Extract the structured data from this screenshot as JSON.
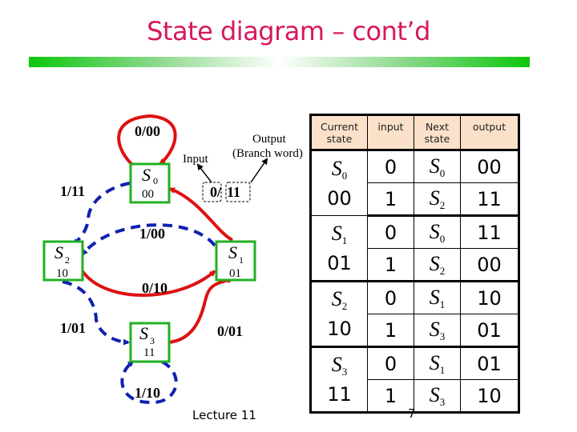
{
  "slide": {
    "title": "State diagram – cont’d",
    "footer": "Lecture 11",
    "page_number": "7",
    "colors": {
      "title": "#d6185e",
      "title_bar": "#0cc70c",
      "state_box": "#22b022",
      "input0_edge": "#dd1111",
      "input1_edge": "#1020b0",
      "table_header_bg": "#fbe1c9"
    }
  },
  "diagram": {
    "states": [
      {
        "name": "S",
        "sub": "0",
        "code": "00"
      },
      {
        "name": "S",
        "sub": "1",
        "code": "01"
      },
      {
        "name": "S",
        "sub": "2",
        "code": "10"
      },
      {
        "name": "S",
        "sub": "3",
        "code": "11"
      }
    ],
    "transitions": [
      {
        "from": "S0",
        "to": "S0",
        "label": "0/00",
        "style": "solid-red"
      },
      {
        "from": "S0",
        "to": "S2",
        "label": "1/11",
        "style": "dashed-blue"
      },
      {
        "from": "S1",
        "to": "S0",
        "label": "0/11",
        "style": "solid-red"
      },
      {
        "from": "S1",
        "to": "S2",
        "label": "1/00",
        "style": "dashed-blue"
      },
      {
        "from": "S2",
        "to": "S1",
        "label": "0/10",
        "style": "solid-red"
      },
      {
        "from": "S2",
        "to": "S3",
        "label": "1/01",
        "style": "dashed-blue"
      },
      {
        "from": "S3",
        "to": "S1",
        "label": "0/01",
        "style": "solid-red"
      },
      {
        "from": "S3",
        "to": "S3",
        "label": "1/10",
        "style": "dashed-blue"
      }
    ],
    "annotation": {
      "input_label": "Input",
      "output_label_line1": "Output",
      "output_label_line2": "(Branch word)",
      "example_input": "0/",
      "example_output": "11"
    }
  },
  "table": {
    "headers": [
      {
        "line1": "Current",
        "line2": "state"
      },
      {
        "line1": "input",
        "line2": ""
      },
      {
        "line1": "Next",
        "line2": "state"
      },
      {
        "line1": "output",
        "line2": ""
      }
    ],
    "groups": [
      {
        "state": "S",
        "sub": "0",
        "code": "00",
        "rows": [
          {
            "input": "0",
            "next": "S",
            "next_sub": "0",
            "output": "00"
          },
          {
            "input": "1",
            "next": "S",
            "next_sub": "2",
            "output": "11"
          }
        ]
      },
      {
        "state": "S",
        "sub": "1",
        "code": "01",
        "rows": [
          {
            "input": "0",
            "next": "S",
            "next_sub": "0",
            "output": "11"
          },
          {
            "input": "1",
            "next": "S",
            "next_sub": "2",
            "output": "00"
          }
        ]
      },
      {
        "state": "S",
        "sub": "2",
        "code": "10",
        "rows": [
          {
            "input": "0",
            "next": "S",
            "next_sub": "1",
            "output": "10"
          },
          {
            "input": "1",
            "next": "S",
            "next_sub": "3",
            "output": "01"
          }
        ]
      },
      {
        "state": "S",
        "sub": "3",
        "code": "11",
        "rows": [
          {
            "input": "0",
            "next": "S",
            "next_sub": "1",
            "output": "01"
          },
          {
            "input": "1",
            "next": "S",
            "next_sub": "3",
            "output": "10"
          }
        ]
      }
    ]
  }
}
